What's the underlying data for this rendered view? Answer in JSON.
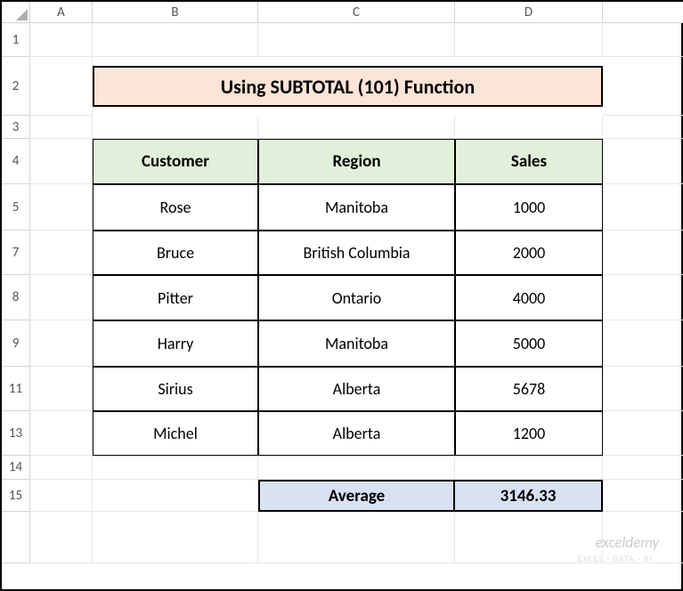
{
  "columns": [
    "A",
    "B",
    "C",
    "D"
  ],
  "rows": [
    "1",
    "2",
    "3",
    "4",
    "5",
    "7",
    "8",
    "9",
    "11",
    "13",
    "14",
    "15"
  ],
  "title": "Using SUBTOTAL (101)  Function",
  "table": {
    "headers": [
      "Customer",
      "Region",
      "Sales"
    ],
    "rows": [
      {
        "customer": "Rose",
        "region": "Manitoba",
        "sales": "1000"
      },
      {
        "customer": "Bruce",
        "region": "British Columbia",
        "sales": "2000"
      },
      {
        "customer": "Pitter",
        "region": "Ontario",
        "sales": "4000"
      },
      {
        "customer": "Harry",
        "region": "Manitoba",
        "sales": "5000"
      },
      {
        "customer": "Sirius",
        "region": "Alberta",
        "sales": "5678"
      },
      {
        "customer": "Michel",
        "region": "Alberta",
        "sales": "1200"
      }
    ]
  },
  "average": {
    "label": "Average",
    "value": "3146.33"
  },
  "watermark": "exceldemy",
  "watermark_sub": "EXCEL · DATA · BI"
}
